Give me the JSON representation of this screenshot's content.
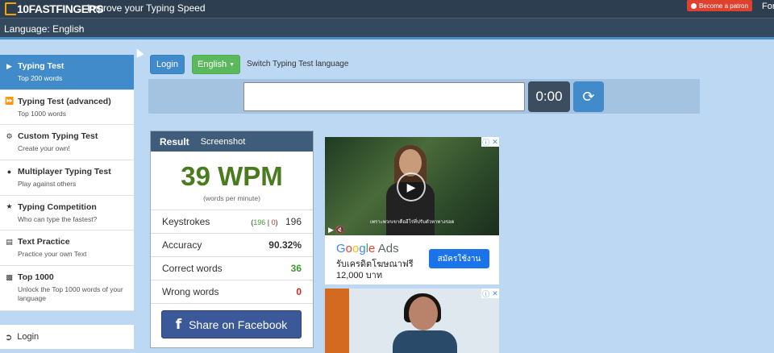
{
  "header": {
    "logo": "10FASTFINGERS",
    "tagline": "Improve your Typing Speed",
    "patron": "Become a patron",
    "right_text": "For"
  },
  "language_bar": {
    "label": "Language: English"
  },
  "sidebar": {
    "items": [
      {
        "title": "Typing Test",
        "subtitle": "Top 200 words",
        "icon": "play-icon",
        "active": true
      },
      {
        "title": "Typing Test (advanced)",
        "subtitle": "Top 1000 words",
        "icon": "fast-forward-icon"
      },
      {
        "title": "Custom Typing Test",
        "subtitle": "Create your own!",
        "icon": "cogs-icon"
      },
      {
        "title": "Multiplayer Typing Test",
        "subtitle": "Play against others",
        "icon": "users-icon"
      },
      {
        "title": "Typing Competition",
        "subtitle": "Who can type the fastest?",
        "icon": "trophy-icon"
      },
      {
        "title": "Text Practice",
        "subtitle": "Practice your own Text",
        "icon": "file-icon"
      },
      {
        "title": "Top 1000",
        "subtitle": "Unlock the Top 1000 words of your language",
        "icon": "bar-chart-icon"
      }
    ],
    "login": "Login"
  },
  "toolbar": {
    "login": "Login",
    "language": "English",
    "switch_text": "Switch Typing Test language"
  },
  "typing": {
    "input_value": "",
    "timer": "0:00"
  },
  "result": {
    "title": "Result",
    "screenshot": "Screenshot",
    "wpm": "39 WPM",
    "wpm_sub": "(words per minute)",
    "stats": {
      "keystrokes_label": "Keystrokes",
      "keystrokes_correct": "196",
      "keystrokes_wrong": "0",
      "keystrokes_total": "196",
      "accuracy_label": "Accuracy",
      "accuracy_value": "90.32%",
      "correct_label": "Correct words",
      "correct_value": "36",
      "wrong_label": "Wrong words",
      "wrong_value": "0"
    },
    "facebook": "Share on Facebook"
  },
  "ad": {
    "caption": "เพราะพวกเขาคือฮีโร่ที่ปรับตัวหาทางรอด",
    "brand_g": "G",
    "brand_o1": "o",
    "brand_o2": "o",
    "brand_g2": "g",
    "brand_l": "l",
    "brand_e": "e",
    "brand_ads": "Ads",
    "line1": "รับเครดิตโฆษณาฟรี",
    "line2": "12,000 บาท",
    "cta": "สมัครใช้งาน"
  },
  "colors": {
    "active_sidebar": "#428bca",
    "wpm_green": "#4a7c1f",
    "facebook": "#3b5998"
  }
}
